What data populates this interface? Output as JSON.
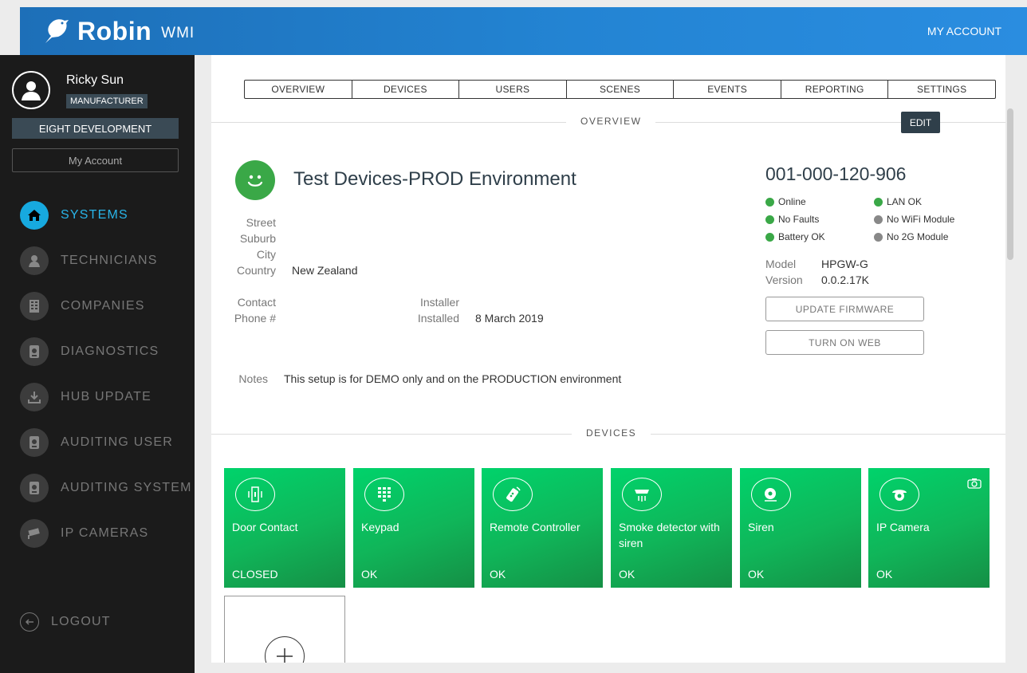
{
  "header": {
    "brand": "Robin",
    "product": "WMI",
    "my_account": "MY ACCOUNT"
  },
  "user": {
    "name": "Ricky Sun",
    "role": "MANUFACTURER",
    "company": "EIGHT DEVELOPMENT",
    "account_button": "My Account"
  },
  "nav": [
    {
      "label": "SYSTEMS",
      "icon": "home-icon",
      "active": true
    },
    {
      "label": "TECHNICIANS",
      "icon": "person-icon",
      "active": false
    },
    {
      "label": "COMPANIES",
      "icon": "building-icon",
      "active": false
    },
    {
      "label": "DIAGNOSTICS",
      "icon": "diagnostics-icon",
      "active": false
    },
    {
      "label": "HUB UPDATE",
      "icon": "download-icon",
      "active": false
    },
    {
      "label": "AUDITING USER",
      "icon": "audit-user-icon",
      "active": false
    },
    {
      "label": "AUDITING SYSTEM",
      "icon": "audit-system-icon",
      "active": false
    },
    {
      "label": "IP CAMERAS",
      "icon": "camera-icon",
      "active": false
    }
  ],
  "logout": "LOGOUT",
  "tabs": [
    "OVERVIEW",
    "DEVICES",
    "USERS",
    "SCENES",
    "EVENTS",
    "REPORTING",
    "SETTINGS"
  ],
  "overview": {
    "section_title": "OVERVIEW",
    "edit": "EDIT",
    "system_name": "Test Devices-PROD Environment",
    "labels": {
      "street": "Street",
      "suburb": "Suburb",
      "city": "City",
      "country": "Country",
      "contact": "Contact",
      "phone": "Phone #",
      "installer": "Installer",
      "installed": "Installed",
      "notes": "Notes",
      "model": "Model",
      "version": "Version"
    },
    "country": "New Zealand",
    "installed": "8 March 2019",
    "notes": "This setup is for DEMO only and on the PRODUCTION environment",
    "serial": "001-000-120-906",
    "statuses": [
      {
        "text": "Online",
        "color": "green"
      },
      {
        "text": "LAN OK",
        "color": "green"
      },
      {
        "text": "No Faults",
        "color": "green"
      },
      {
        "text": "No WiFi Module",
        "color": "gray"
      },
      {
        "text": "Battery OK",
        "color": "green"
      },
      {
        "text": "No 2G Module",
        "color": "gray"
      }
    ],
    "model": "HPGW-G",
    "version": "0.0.2.17K",
    "update_firmware": "UPDATE FIRMWARE",
    "turn_on_web": "TURN ON WEB"
  },
  "devices": {
    "section_title": "DEVICES",
    "items": [
      {
        "name": "Door Contact",
        "state": "CLOSED",
        "icon": "door-contact-icon"
      },
      {
        "name": "Keypad",
        "state": "OK",
        "icon": "keypad-icon"
      },
      {
        "name": "Remote Controller",
        "state": "OK",
        "icon": "remote-icon"
      },
      {
        "name": "Smoke detector with siren",
        "state": "OK",
        "icon": "smoke-detector-icon"
      },
      {
        "name": "Siren",
        "state": "OK",
        "icon": "siren-icon"
      },
      {
        "name": "IP Camera",
        "state": "OK",
        "icon": "ip-camera-icon"
      }
    ]
  },
  "colors": {
    "header_blue": "#2384d3",
    "active_nav": "#29b4e8",
    "tile_green": "#10b559",
    "dark_slate": "#2f3f4a"
  }
}
